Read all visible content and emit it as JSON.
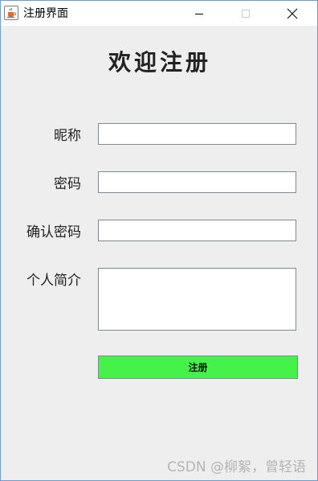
{
  "window": {
    "title": "注册界面"
  },
  "form": {
    "heading": "欢迎注册",
    "nickname_label": "昵称",
    "nickname_value": "",
    "password_label": "密码",
    "password_value": "",
    "confirm_label": "确认密码",
    "confirm_value": "",
    "bio_label": "个人简介",
    "bio_value": "",
    "submit_label": "注册",
    "submit_color": "#44f24a"
  },
  "watermark": "CSDN @柳絮，曾轻语",
  "icons": {
    "app": "java-cup-icon",
    "minimize": "minimize-icon",
    "maximize": "maximize-icon",
    "close": "close-icon"
  }
}
